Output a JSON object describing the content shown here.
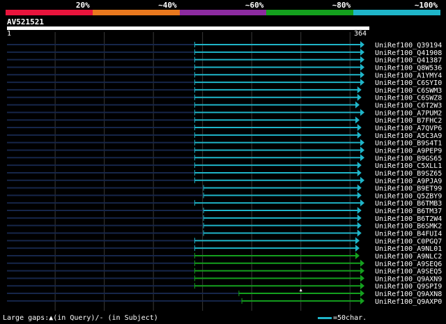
{
  "legend": {
    "colors": [
      "#e8143c",
      "#e8781e",
      "#8c2ba0",
      "#14a01e",
      "#1fb5c9"
    ],
    "labels": [
      "20%",
      "~40%",
      "~60%",
      "~80%",
      "~100%"
    ]
  },
  "query": {
    "name": "AV521521",
    "start_label": "1",
    "end_label": "364"
  },
  "footer": {
    "gaps_text": "Large gaps:▲(in Query)/- (in Subject)",
    "scale_text": "=50char."
  },
  "chart_data": {
    "type": "alignment",
    "query_length": 364,
    "color_scale": {
      "cyan": "~100%",
      "green": "~80%"
    },
    "hits": [
      {
        "name": "UniRef100_Q39194",
        "start": 192,
        "end": 364,
        "color": "#1fb5c9"
      },
      {
        "name": "UniRef100_Q41908",
        "start": 192,
        "end": 364,
        "color": "#1fb5c9"
      },
      {
        "name": "UniRef100_Q41387",
        "start": 192,
        "end": 364,
        "color": "#1fb5c9"
      },
      {
        "name": "UniRef100_Q8W536",
        "start": 192,
        "end": 364,
        "color": "#1fb5c9"
      },
      {
        "name": "UniRef100_A1YMY4",
        "start": 192,
        "end": 364,
        "color": "#1fb5c9"
      },
      {
        "name": "UniRef100_C6SYI0",
        "start": 192,
        "end": 364,
        "color": "#1fb5c9"
      },
      {
        "name": "UniRef100_C6SWM3",
        "start": 192,
        "end": 361,
        "color": "#1fb5c9"
      },
      {
        "name": "UniRef100_C6SWZ8",
        "start": 192,
        "end": 361,
        "color": "#1fb5c9"
      },
      {
        "name": "UniRef100_C6T2W3",
        "start": 192,
        "end": 359,
        "color": "#1fb5c9"
      },
      {
        "name": "UniRef100_A7PUM2",
        "start": 192,
        "end": 364,
        "color": "#1fb5c9"
      },
      {
        "name": "UniRef100_B7FHC2",
        "start": 192,
        "end": 359,
        "color": "#1fb5c9"
      },
      {
        "name": "UniRef100_A7QVP6",
        "start": 192,
        "end": 361,
        "color": "#1fb5c9"
      },
      {
        "name": "UniRef100_A5C3A9",
        "start": 192,
        "end": 361,
        "color": "#1fb5c9"
      },
      {
        "name": "UniRef100_B9S4T1",
        "start": 192,
        "end": 364,
        "color": "#1fb5c9"
      },
      {
        "name": "UniRef100_A9PEP9",
        "start": 192,
        "end": 364,
        "color": "#1fb5c9"
      },
      {
        "name": "UniRef100_B9GS65",
        "start": 192,
        "end": 364,
        "color": "#1fb5c9"
      },
      {
        "name": "UniRef100_C5XLL1",
        "start": 192,
        "end": 361,
        "color": "#1fb5c9"
      },
      {
        "name": "UniRef100_B9SZ65",
        "start": 192,
        "end": 361,
        "color": "#1fb5c9"
      },
      {
        "name": "UniRef100_A9PJA9",
        "start": 192,
        "end": 364,
        "color": "#1fb5c9"
      },
      {
        "name": "UniRef100_B9ET99",
        "start": 201,
        "end": 361,
        "color": "#1fb5c9"
      },
      {
        "name": "UniRef100_Q5ZBY9",
        "start": 201,
        "end": 361,
        "color": "#1fb5c9"
      },
      {
        "name": "UniRef100_B6TMB3",
        "start": 192,
        "end": 364,
        "color": "#1fb5c9"
      },
      {
        "name": "UniRef100_B6TM37",
        "start": 201,
        "end": 361,
        "color": "#1fb5c9"
      },
      {
        "name": "UniRef100_B6T2W4",
        "start": 201,
        "end": 361,
        "color": "#1fb5c9"
      },
      {
        "name": "UniRef100_B6SMK2",
        "start": 201,
        "end": 361,
        "color": "#1fb5c9"
      },
      {
        "name": "UniRef100_B4FUI4",
        "start": 201,
        "end": 361,
        "color": "#1fb5c9"
      },
      {
        "name": "UniRef100_C0PGQ7",
        "start": 192,
        "end": 359,
        "color": "#1fb5c9"
      },
      {
        "name": "UniRef100_A9NL01",
        "start": 192,
        "end": 359,
        "color": "#1fb5c9"
      },
      {
        "name": "UniRef100_A9NLC2",
        "start": 192,
        "end": 359,
        "color": "#14a01e"
      },
      {
        "name": "UniRef100_A9SEQ6",
        "start": 192,
        "end": 364,
        "color": "#14a01e"
      },
      {
        "name": "UniRef100_A9SEQ5",
        "start": 192,
        "end": 364,
        "color": "#14a01e"
      },
      {
        "name": "UniRef100_Q9AXN9",
        "start": 192,
        "end": 364,
        "color": "#14a01e"
      },
      {
        "name": "UniRef100_Q9SPI9",
        "start": 192,
        "end": 364,
        "color": "#14a01e",
        "gap_mark": 300
      },
      {
        "name": "UniRef100_Q9AXN8",
        "start": 237,
        "end": 364,
        "color": "#14a01e"
      },
      {
        "name": "UniRef100_Q9AXP0",
        "start": 240,
        "end": 364,
        "color": "#14a01e"
      }
    ]
  }
}
